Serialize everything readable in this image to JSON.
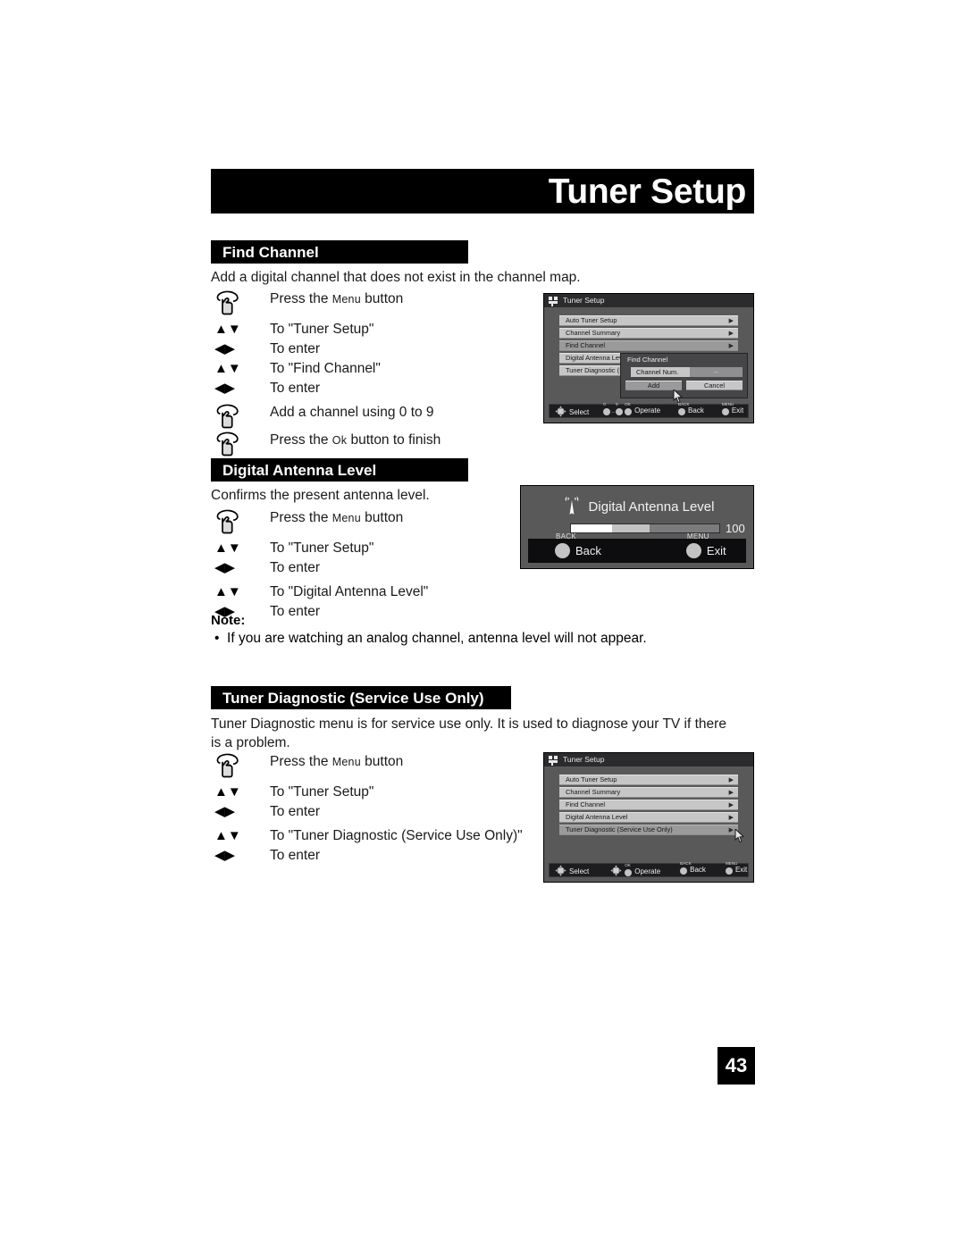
{
  "page": {
    "header_title": "Tuner Setup",
    "page_number": "43"
  },
  "sections": {
    "find_channel": {
      "heading": "Find Channel",
      "intro": "Add a digital channel that does not exist in the channel map.",
      "steps": [
        {
          "icon": "hand-press-icon",
          "text_prefix": "Press the ",
          "smallcaps": "Menu",
          "text_suffix": " button"
        },
        {
          "icon": "up-down-arrows-icon",
          "text": "To \"Tuner Setup\""
        },
        {
          "icon": "left-right-arrows-icon",
          "text": "To enter"
        },
        {
          "icon": "up-down-arrows-icon",
          "text": "To \"Find Channel\""
        },
        {
          "icon": "left-right-arrows-icon",
          "text": "To enter"
        },
        {
          "icon": "hand-press-icon",
          "text": "Add a channel using 0 to 9"
        },
        {
          "icon": "hand-press-icon",
          "text_prefix": "Press the ",
          "smallcaps": "Ok",
          "text_suffix": " button to finish"
        }
      ]
    },
    "digital_antenna_level": {
      "heading": "Digital Antenna Level",
      "intro": "Confirms the present antenna level.",
      "steps": [
        {
          "icon": "hand-press-icon",
          "text_prefix": "Press the ",
          "smallcaps": "Menu",
          "text_suffix": " button"
        },
        {
          "icon": "up-down-arrows-icon",
          "text": "To \"Tuner Setup\""
        },
        {
          "icon": "left-right-arrows-icon",
          "text": "To enter"
        },
        {
          "icon": "up-down-arrows-icon",
          "text": "To \"Digital Antenna Level\""
        },
        {
          "icon": "left-right-arrows-icon",
          "text": "To enter"
        }
      ],
      "note_title": "Note:",
      "note_bullet": "If you are watching an analog channel, antenna level will not appear."
    },
    "tuner_diagnostic": {
      "heading": "Tuner Diagnostic (Service Use Only)",
      "intro": "Tuner Diagnostic menu is for service use only.  It is used to diagnose your TV if there is a problem.",
      "steps": [
        {
          "icon": "hand-press-icon",
          "text_prefix": "Press the ",
          "smallcaps": "Menu",
          "text_suffix": " button"
        },
        {
          "icon": "up-down-arrows-icon",
          "text": "To \"Tuner Setup\""
        },
        {
          "icon": "left-right-arrows-icon",
          "text": "To enter"
        },
        {
          "icon": "up-down-arrows-icon",
          "text": "To \"Tuner Diagnostic (Service Use Only)\""
        },
        {
          "icon": "left-right-arrows-icon",
          "text": "To enter"
        }
      ]
    }
  },
  "screenshots": {
    "find_channel_menu": {
      "titlebar": "Tuner Setup",
      "menu_items": [
        "Auto Tuner Setup",
        "Channel Summary",
        "Find Channel",
        "Digital Antenna Level",
        "Tuner Diagnostic (Service Use Only)"
      ],
      "selected_index": 2,
      "dialog": {
        "title": "Find Channel",
        "field_label": "Channel Num.",
        "field_value": "--",
        "add_label": "Add",
        "cancel_label": "Cancel"
      },
      "guide": {
        "select": "Select",
        "operate": "Operate",
        "back": "Back",
        "exit": "Exit",
        "num_low": "0",
        "num_high": "9",
        "ok_cap": "OK",
        "back_cap": "BACK",
        "menu_cap": "MENU"
      }
    },
    "antenna_level": {
      "title": "Digital Antenna Level",
      "value": "100",
      "back_label": "Back",
      "back_cap": "BACK",
      "exit_label": "Exit",
      "exit_cap": "MENU",
      "meter_segments": [
        {
          "color": "#ffffff",
          "pct": 28
        },
        {
          "color": "#c2c2c2",
          "pct": 25
        },
        {
          "color": "#7b7b7b",
          "pct": 47
        }
      ]
    },
    "tuner_diagnostic_menu": {
      "titlebar": "Tuner Setup",
      "menu_items": [
        "Auto Tuner Setup",
        "Channel Summary",
        "Find Channel",
        "Digital Antenna Level",
        "Tuner Diagnostic (Service Use Only)"
      ],
      "selected_index": 4,
      "guide": {
        "select": "Select",
        "operate": "Operate",
        "back": "Back",
        "exit": "Exit",
        "ok_cap": "OK",
        "back_cap": "BACK",
        "menu_cap": "MENU"
      }
    }
  }
}
